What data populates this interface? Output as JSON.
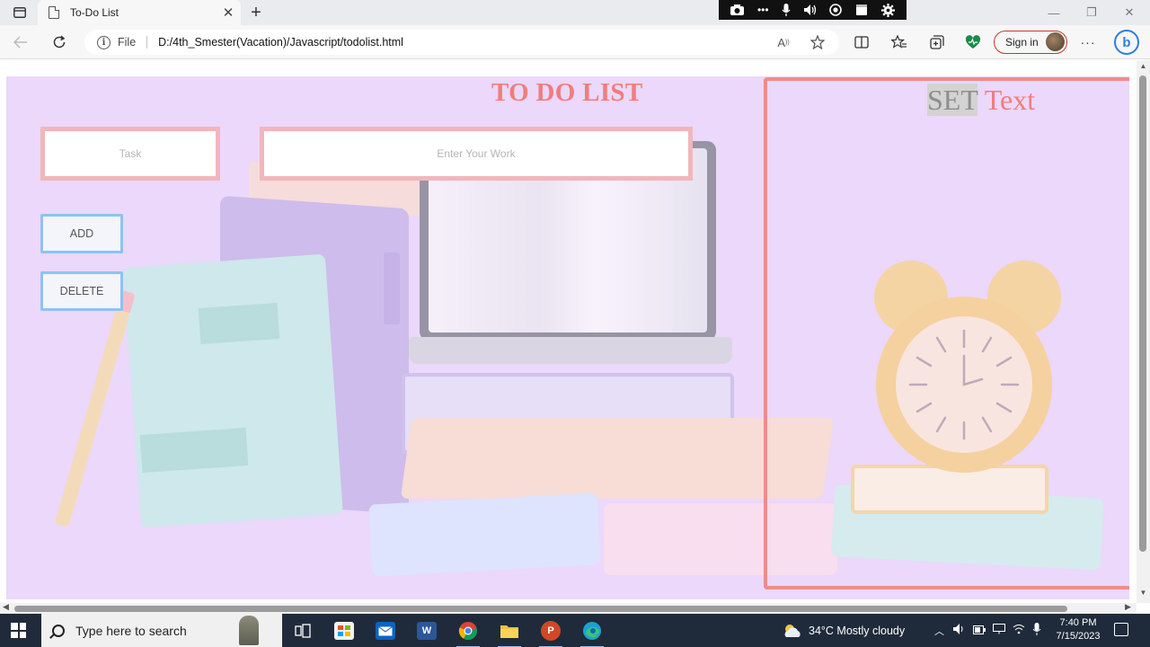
{
  "browser": {
    "tab_title": "To-Do List",
    "tab_close": "✕",
    "new_tab": "+",
    "scheme_label": "File",
    "url": "D:/4th_Smester(Vacation)/Javascript/todolist.html",
    "signin_label": "Sign in",
    "window_controls": {
      "minimize": "—",
      "restore": "❐",
      "close": "✕"
    },
    "recorder_icons": [
      "camera-icon",
      "more-icon",
      "mic-icon",
      "volume-icon",
      "record-icon",
      "window-icon",
      "gear-icon"
    ]
  },
  "app": {
    "title": "TO DO LIST",
    "task_placeholder": "Task",
    "work_placeholder": "Enter Your Work",
    "add_label": "ADD",
    "delete_label": "DELETE",
    "set_word": "SET",
    "text_word": "Text"
  },
  "colors": {
    "accent": "#f07d7d",
    "input_border": "#f2b6bb",
    "button_border": "#8ec2f2",
    "panel_border": "#ee8c8d",
    "page_background": "#e6cdf8"
  },
  "taskbar": {
    "search_placeholder": "Type here to search",
    "weather": "34°C  Mostly cloudy",
    "time": "7:40 PM",
    "date": "7/15/2023",
    "apps": [
      "task-view-icon",
      "store-icon",
      "mail-icon",
      "word-icon",
      "chrome-icon",
      "file-explorer-icon",
      "powerpoint-icon",
      "edge-icon"
    ]
  }
}
